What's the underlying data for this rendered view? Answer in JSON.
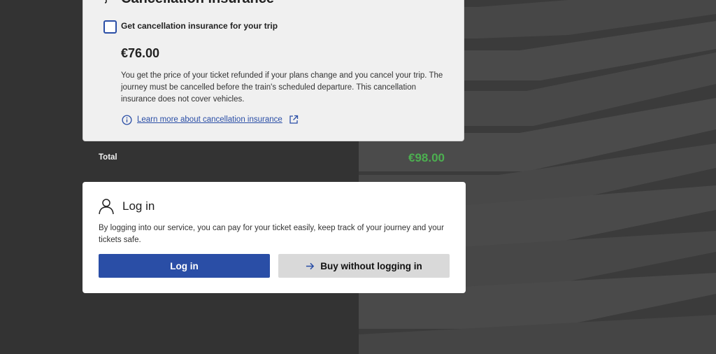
{
  "insurance": {
    "title": "Cancellation insurance",
    "checkbox_label": "Get cancellation insurance for your trip",
    "checked": false,
    "price": "€76.00",
    "description": "You get the price of your ticket refunded if your plans change and you cancel your trip. The journey must be cancelled before the train's scheduled departure. This cancellation insurance does not cover vehicles.",
    "learn_more": "Learn more about cancellation insurance"
  },
  "total": {
    "label": "Total",
    "value": "€98.00"
  },
  "login": {
    "title": "Log in",
    "description": "By logging into our service, you can pay for your ticket easily, keep track of your journey and your tickets safe.",
    "login_button": "Log in",
    "buy_button": "Buy without logging in"
  },
  "colors": {
    "accent": "#2a4ea6",
    "total": "#4caf50",
    "background": "#333333"
  }
}
